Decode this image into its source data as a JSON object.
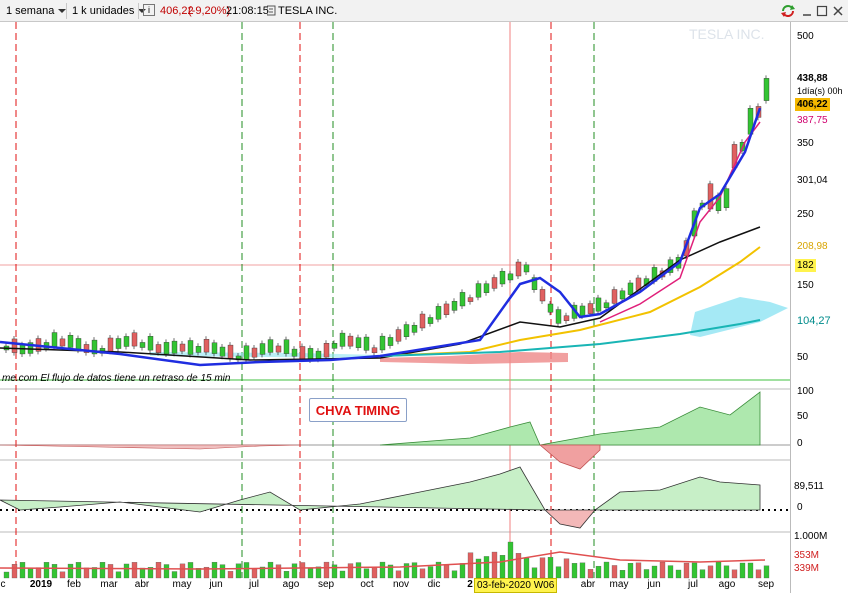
{
  "toolbar": {
    "period": "1 semana",
    "units": "1 k unidades",
    "info_icon": "info-icon",
    "price": "406,22",
    "change": "(-9,20%)",
    "time": "21:08:15",
    "market_icon": "market-icon",
    "symbol": "TESLA INC.",
    "sync_icon": "sync-icon",
    "minimize_icon": "minimize-icon",
    "maximize_icon": "maximize-icon",
    "close_icon": "close-icon"
  },
  "chart": {
    "watermark": "TESLA INC.",
    "delay_notice": "me.com  El flujo de datos tiene un retraso de 15 min",
    "indicator_label": "CHVA TIMING",
    "date_tag": "03-feb-2020 W06"
  },
  "price_axis": {
    "ticks": [
      "500",
      "350",
      "250",
      "150",
      "50"
    ],
    "labels": [
      {
        "text": "438,88",
        "bg": "#ffffff",
        "color": "#000000"
      },
      {
        "text": "1día(s) 00h",
        "bg": "#ffffff",
        "color": "#000000"
      },
      {
        "text": "406,22",
        "bg": "#f5b800",
        "color": "#000000"
      },
      {
        "text": "387,75",
        "bg": "#ffffff",
        "color": "#d0006f"
      },
      {
        "text": "301,04",
        "bg": "#ffffff",
        "color": "#000000"
      },
      {
        "text": "208,98",
        "bg": "#ffffff",
        "color": "#d8a400"
      },
      {
        "text": "182",
        "bg": "#fff34d",
        "color": "#000000"
      },
      {
        "text": "104,27",
        "bg": "#ffffff",
        "color": "#008c8c"
      }
    ]
  },
  "osc1_axis": {
    "ticks": [
      "100",
      "50",
      "0"
    ]
  },
  "osc2_axis": {
    "ticks": [
      "89,511",
      "0"
    ]
  },
  "volume_axis": {
    "ticks": [
      "1.000M",
      "353M",
      "339M"
    ]
  },
  "x_axis": {
    "labels": [
      "c",
      "2019",
      "feb",
      "mar",
      "abr",
      "may",
      "jun",
      "jul",
      "ago",
      "sep",
      "oct",
      "nov",
      "dic",
      "2",
      "r",
      "abr",
      "may",
      "jun",
      "jul",
      "ago",
      "sep"
    ]
  },
  "colors": {
    "up": "#33c433",
    "down": "#e06060",
    "ema_blue": "#1f2de0",
    "ema_pink": "#e0207a",
    "sma_black": "#111111",
    "sma_yellow": "#f2c200",
    "sma_teal": "#19b5b5",
    "cloud": "#8ee4f2",
    "red_vline": "#e01010",
    "green_vline": "#208c20"
  }
}
